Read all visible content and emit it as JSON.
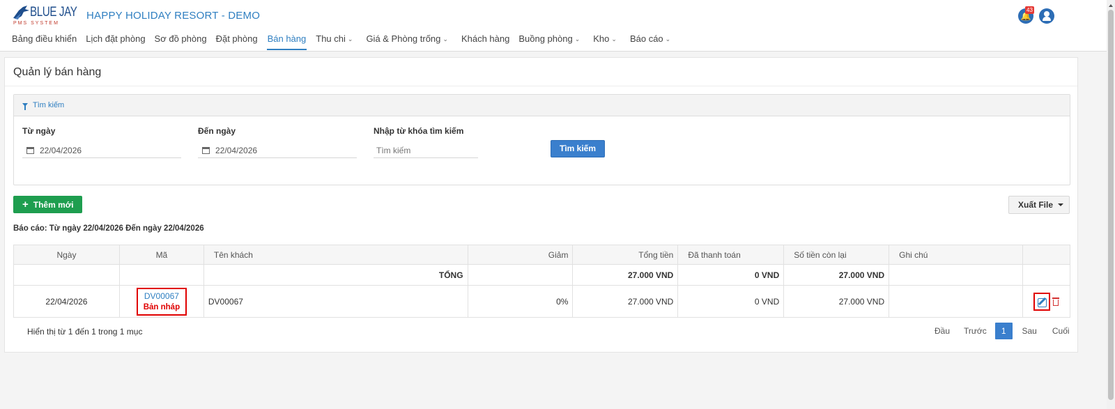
{
  "header": {
    "logo_text": "BLUE JAY",
    "logo_sub": "PMS SYSTEM",
    "resort_name": "HAPPY HOLIDAY RESORT - DEMO",
    "notifications_count": "43"
  },
  "nav": {
    "items": [
      {
        "label": "Bảng điều khiển"
      },
      {
        "label": "Lịch đặt phòng"
      },
      {
        "label": "Sơ đồ phòng"
      },
      {
        "label": "Đặt phòng"
      },
      {
        "label": "Bán hàng"
      },
      {
        "label": "Thu chi"
      },
      {
        "label": "Giá & Phòng trống"
      },
      {
        "label": "Khách hàng"
      },
      {
        "label": "Buồng phòng"
      },
      {
        "label": "Kho"
      },
      {
        "label": "Báo cáo"
      }
    ],
    "active": "Bán hàng"
  },
  "page": {
    "title": "Quản lý bán hàng"
  },
  "search": {
    "header": "Tìm kiếm",
    "from_label": "Từ ngày",
    "from_value": "22/04/2026",
    "to_label": "Đến ngày",
    "to_value": "22/04/2026",
    "keyword_label": "Nhập từ khóa tìm kiếm",
    "keyword_placeholder": "Tìm kiếm",
    "button": "Tìm kiếm"
  },
  "actions": {
    "add": "Thêm mới",
    "export": "Xuất File"
  },
  "report_range": "Báo cáo: Từ ngày 22/04/2026 Đến ngày 22/04/2026",
  "table": {
    "columns": [
      "Ngày",
      "Mã",
      "Tên khách",
      "Giảm",
      "Tổng tiền",
      "Đã thanh toán",
      "Số tiền còn lại",
      "Ghi chú"
    ],
    "total": {
      "label": "TỔNG",
      "total_amount": "27.000 VND",
      "paid": "0 VND",
      "remaining": "27.000 VND"
    },
    "rows": [
      {
        "date": "22/04/2026",
        "code": "DV00067",
        "status": "Bản nháp",
        "customer": "DV00067",
        "discount": "0%",
        "total_amount": "27.000 VND",
        "paid": "0 VND",
        "remaining": "27.000 VND",
        "note": ""
      }
    ]
  },
  "pagination": {
    "info": "Hiển thị từ 1 đến 1 trong 1 mục",
    "first": "Đầu",
    "prev": "Trước",
    "current": "1",
    "next": "Sau",
    "last": "Cuối"
  },
  "colors": {
    "primary": "#3a7fcd",
    "success": "#1e9e4f",
    "danger": "#e00000"
  }
}
